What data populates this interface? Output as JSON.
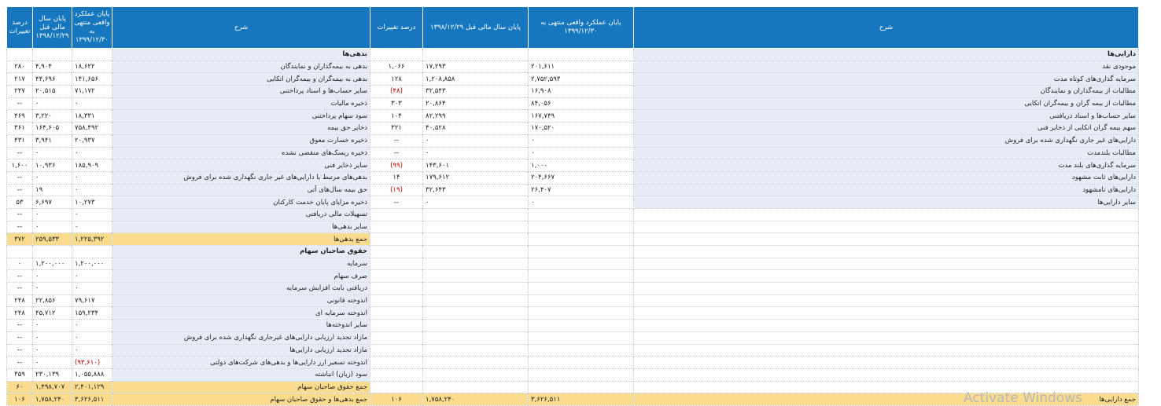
{
  "headers": {
    "assets": {
      "desc": "شرح",
      "actual": "پایان عملکرد واقعی منتهی به ۱۳۹۹/۱۲/۳۰",
      "prior": "پایان سال مالی قبل ۱۳۹۸/۱۲/۲۹",
      "pct": "درصد تغییرات"
    },
    "liabilities": {
      "desc": "شرح",
      "actual": "پایان عملکرد واقعی منتهی به ۱۳۹۹/۱۲/۳۰",
      "prior": "پایان سال مالی قبل ۱۳۹۸/۱۲/۲۹",
      "pct": "درصد تغییرات"
    }
  },
  "rows": [
    {
      "a": {
        "d": "دارایی‌ها",
        "v1": "",
        "v2": "",
        "p": "",
        "bold": true
      },
      "l": {
        "d": "بدهی‌ها",
        "v1": "",
        "v2": "",
        "p": "",
        "bold": true
      }
    },
    {
      "a": {
        "d": "موجودی نقد",
        "v1": "۲۰۱,۶۱۱",
        "v2": "۱۷,۲۹۳",
        "p": "۱,۰۶۶"
      },
      "l": {
        "d": "بدهی به بیمه‌گذاران و نمایندگان",
        "v1": "۱۸,۶۲۲",
        "v2": "۴,۹۰۴",
        "p": "۲۸۰"
      }
    },
    {
      "a": {
        "d": "سرمایه گذاری‌های کوتاه مدت",
        "v1": "۲,۷۵۲,۵۹۳",
        "v2": "۱,۲۰۸,۸۵۸",
        "p": "۱۲۸"
      },
      "l": {
        "d": "بدهی به بیمه‌گران و بیمه‌گران اتکایی",
        "v1": "۱۴۱,۶۵۶",
        "v2": "۴۴,۶۹۶",
        "p": "۲۱۷"
      }
    },
    {
      "a": {
        "d": "مطالبات از بیمه‌گذاران و نمایندگان",
        "v1": "۱۶,۹۰۸",
        "v2": "۳۲,۵۴۳",
        "p": "(۴۸)",
        "neg": true
      },
      "l": {
        "d": "سایر حساب‌ها و اسناد پرداختنی",
        "v1": "۷۱,۱۷۲",
        "v2": "۲۰,۵۱۵",
        "p": "۲۴۷"
      }
    },
    {
      "a": {
        "d": "مطالبات از بیمه گران و بیمه‌گران اتکایی",
        "v1": "۸۴,۰۵۶",
        "v2": "۲۰,۸۶۴",
        "p": "۳۰۳"
      },
      "l": {
        "d": "ذخیره مالیات",
        "v1": "۰",
        "v2": "۰",
        "p": "--"
      }
    },
    {
      "a": {
        "d": "سایر حساب‌ها و اسناد دریافتنی",
        "v1": "۱۶۷,۷۴۹",
        "v2": "۸۲,۲۹۹",
        "p": "۱۰۴"
      },
      "l": {
        "d": "سود سهام پرداختنی",
        "v1": "۱۸,۳۳۱",
        "v2": "۳,۲۲۰",
        "p": "۴۶۹"
      }
    },
    {
      "a": {
        "d": "سهم بیمه گران اتکایی از ذخایر فنی",
        "v1": "۱۷۰,۵۲۰",
        "v2": "۴۰,۵۲۸",
        "p": "۳۲۱"
      },
      "l": {
        "d": "ذخایر حق بیمه",
        "v1": "۷۵۸,۴۹۲",
        "v2": "۱۶۴,۶۰۵",
        "p": "۳۶۱"
      }
    },
    {
      "a": {
        "d": "دارایی‌های غیر جاری نگهداری شده برای فروش",
        "v1": "۰",
        "v2": "۰",
        "p": "--"
      },
      "l": {
        "d": "ذخیره خسارت معوق",
        "v1": "۲۰,۹۳۷",
        "v2": "۳,۹۴۱",
        "p": "۴۳۱"
      }
    },
    {
      "a": {
        "d": "مطالبات بلندمدت",
        "v1": "۰",
        "v2": "۰",
        "p": "--"
      },
      "l": {
        "d": "ذخیره ریسک‌های منقضی نشده",
        "v1": "۰",
        "v2": "۰",
        "p": "--"
      }
    },
    {
      "a": {
        "d": "سرمایه گذاری‌های بلند مدت",
        "v1": "۱,۰۰۰",
        "v2": "۱۴۳,۶۰۱",
        "p": "(۹۹)",
        "neg": true
      },
      "l": {
        "d": "سایر ذخایر فنی",
        "v1": "۱۸۵,۹۰۹",
        "v2": "۱۰,۹۳۶",
        "p": "۱,۶۰۰"
      }
    },
    {
      "a": {
        "d": "دارایی‌های ثابت مشهود",
        "v1": "۲۰۴,۶۶۷",
        "v2": "۱۷۹,۶۱۲",
        "p": "۱۴"
      },
      "l": {
        "d": "بدهی‌های مرتبط با دارایی‌های غیر جاری نگهداری شده برای فروش",
        "v1": "۰",
        "v2": "۰",
        "p": "--"
      }
    },
    {
      "a": {
        "d": "دارایی‌های نامشهود",
        "v1": "۲۶,۴۰۷",
        "v2": "۳۲,۶۴۳",
        "p": "(۱۹)",
        "neg": true
      },
      "l": {
        "d": "حق بیمه سال‌های آتی",
        "v1": "۰",
        "v2": "۱۹",
        "p": "--"
      }
    },
    {
      "a": {
        "d": "سایر دارایی‌ها",
        "v1": "۰",
        "v2": "۰",
        "p": "--"
      },
      "l": {
        "d": "ذخیره مزایای پایان خدمت کارکنان",
        "v1": "۱۰,۲۷۳",
        "v2": "۶,۶۹۷",
        "p": "۵۳"
      }
    },
    {
      "a": null,
      "l": {
        "d": "تسهیلات مالی دریافتی",
        "v1": "۰",
        "v2": "۰",
        "p": "--"
      }
    },
    {
      "a": null,
      "l": {
        "d": "سایر بدهی‌ها",
        "v1": "۰",
        "v2": "۰",
        "p": "--"
      }
    },
    {
      "a": null,
      "l": {
        "d": "جمع بدهی‌ها",
        "v1": "۱,۲۲۵,۳۹۲",
        "v2": "۲۵۹,۵۳۳",
        "p": "۳۷۲",
        "total": true
      }
    },
    {
      "a": null,
      "l": {
        "d": "حقوق صاحبان سهام",
        "v1": "",
        "v2": "",
        "p": "",
        "bold": true
      }
    },
    {
      "a": null,
      "l": {
        "d": "سرمایه",
        "v1": "۱,۲۰۰,۰۰۰",
        "v2": "۱,۲۰۰,۰۰۰",
        "p": "۰"
      }
    },
    {
      "a": null,
      "l": {
        "d": "صرف سهام",
        "v1": "۰",
        "v2": "۰",
        "p": "--"
      }
    },
    {
      "a": null,
      "l": {
        "d": "دریافتی بابت افزایش سرمایه",
        "v1": "۰",
        "v2": "۰",
        "p": "--"
      }
    },
    {
      "a": null,
      "l": {
        "d": "اندوخته قانونی",
        "v1": "۷۹,۶۱۷",
        "v2": "۲۲,۸۵۶",
        "p": "۲۴۸"
      }
    },
    {
      "a": null,
      "l": {
        "d": "اندوخته سرمایه ای",
        "v1": "۱۵۹,۲۳۴",
        "v2": "۴۵,۷۱۲",
        "p": "۲۴۸"
      }
    },
    {
      "a": null,
      "l": {
        "d": "سایر اندوخته‌ها",
        "v1": "۰",
        "v2": "۰",
        "p": "--"
      }
    },
    {
      "a": null,
      "l": {
        "d": "مازاد تجدید ارزیابی دارایی‌های غیرجاری نگهداری شده برای فروش",
        "v1": "۰",
        "v2": "۰",
        "p": "--"
      }
    },
    {
      "a": null,
      "l": {
        "d": "مازاد تجدید ارزیابی دارایی‌ها",
        "v1": "۰",
        "v2": "۰",
        "p": "--"
      }
    },
    {
      "a": null,
      "l": {
        "d": "اندوخته تسعیر ارز دارایی‌ها و بدهی‌های شرکت‌های دولتی",
        "v1": "(۹۳,۶۱۰)",
        "v2": "۰",
        "p": "--",
        "negv1": true
      }
    },
    {
      "a": null,
      "l": {
        "d": "سود (زیان) انباشته",
        "v1": "۱,۰۵۵,۸۸۸",
        "v2": "۲۳۰,۱۳۹",
        "p": "۳۵۹"
      }
    },
    {
      "a": null,
      "l": {
        "d": "جمع حقوق صاحبان سهام",
        "v1": "۲,۴۰۱,۱۲۹",
        "v2": "۱,۴۹۸,۷۰۷",
        "p": "۶۰",
        "total": true
      }
    },
    {
      "a": {
        "d": "جمع دارایی‌ها",
        "v1": "۳,۶۲۶,۵۱۱",
        "v2": "۱,۷۵۸,۲۴۰",
        "p": "۱۰۶",
        "total": true
      },
      "l": {
        "d": "جمع بدهی‌ها و حقوق صاحبان سهام",
        "v1": "۳,۶۲۶,۵۱۱",
        "v2": "۱,۷۵۸,۲۴۰",
        "p": "۱۰۶",
        "total": true
      }
    }
  ],
  "watermark": "Activate Windows"
}
